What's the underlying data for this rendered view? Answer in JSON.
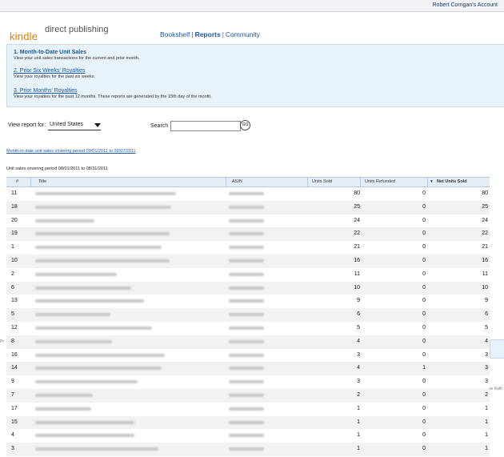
{
  "account": {
    "label": "Robert Corrigan's Account"
  },
  "logo": {
    "brand": "kindle",
    "product": "direct publishing"
  },
  "nav": {
    "bookshelf": "Bookshelf",
    "reports": "Reports",
    "community": "Community"
  },
  "reports": [
    {
      "title": "1. Month-to-Date Unit Sales",
      "desc": "View your unit sales transactions for the current and prior month."
    },
    {
      "title": "2. Prior Six Weeks' Royalties",
      "desc": "View your royalties for the past six weeks."
    },
    {
      "title": "3. Prior Months' Royalties",
      "desc": "View your royalties for the past 12 months. These reports are generated by the 15th day of the month."
    }
  ],
  "filters": {
    "view_label": "View report for:",
    "view_value": "United States",
    "search_label": "Search",
    "go_label": "GO"
  },
  "period": {
    "link": "Month-to-date unit sales covering period 09/01/2011 to 09/07/2011",
    "note": "Unit sales covering period 08/01/2011 to 08/31/2011"
  },
  "table": {
    "headers": [
      "#",
      "Title",
      "ASIN",
      "Units Sold",
      "Units Refunded",
      "Net Units Sold"
    ],
    "sort_indicator": "▾",
    "rows": [
      {
        "num": "11",
        "sold": "80",
        "refunded": "0",
        "net": "80"
      },
      {
        "num": "18",
        "sold": "25",
        "refunded": "0",
        "net": "25"
      },
      {
        "num": "20",
        "sold": "24",
        "refunded": "0",
        "net": "24"
      },
      {
        "num": "19",
        "sold": "22",
        "refunded": "0",
        "net": "22"
      },
      {
        "num": "1",
        "sold": "21",
        "refunded": "0",
        "net": "21"
      },
      {
        "num": "10",
        "sold": "16",
        "refunded": "0",
        "net": "16"
      },
      {
        "num": "2",
        "sold": "11",
        "refunded": "0",
        "net": "11"
      },
      {
        "num": "6",
        "sold": "10",
        "refunded": "0",
        "net": "10"
      },
      {
        "num": "13",
        "sold": "9",
        "refunded": "0",
        "net": "9"
      },
      {
        "num": "5",
        "sold": "6",
        "refunded": "0",
        "net": "6"
      },
      {
        "num": "12",
        "sold": "5",
        "refunded": "0",
        "net": "5"
      },
      {
        "num": "8",
        "sold": "4",
        "refunded": "0",
        "net": "4"
      },
      {
        "num": "16",
        "sold": "3",
        "refunded": "0",
        "net": "3"
      },
      {
        "num": "14",
        "sold": "4",
        "refunded": "1",
        "net": "3"
      },
      {
        "num": "9",
        "sold": "3",
        "refunded": "0",
        "net": "3"
      },
      {
        "num": "7",
        "sold": "2",
        "refunded": "0",
        "net": "2"
      },
      {
        "num": "17",
        "sold": "1",
        "refunded": "0",
        "net": "1"
      },
      {
        "num": "15",
        "sold": "1",
        "refunded": "0",
        "net": "1"
      },
      {
        "num": "4",
        "sold": "1",
        "refunded": "0",
        "net": "1"
      },
      {
        "num": "3",
        "sold": "1",
        "refunded": "0",
        "net": "1"
      }
    ]
  },
  "fragments": {
    "left": "Pr",
    "right": "av Kath"
  }
}
